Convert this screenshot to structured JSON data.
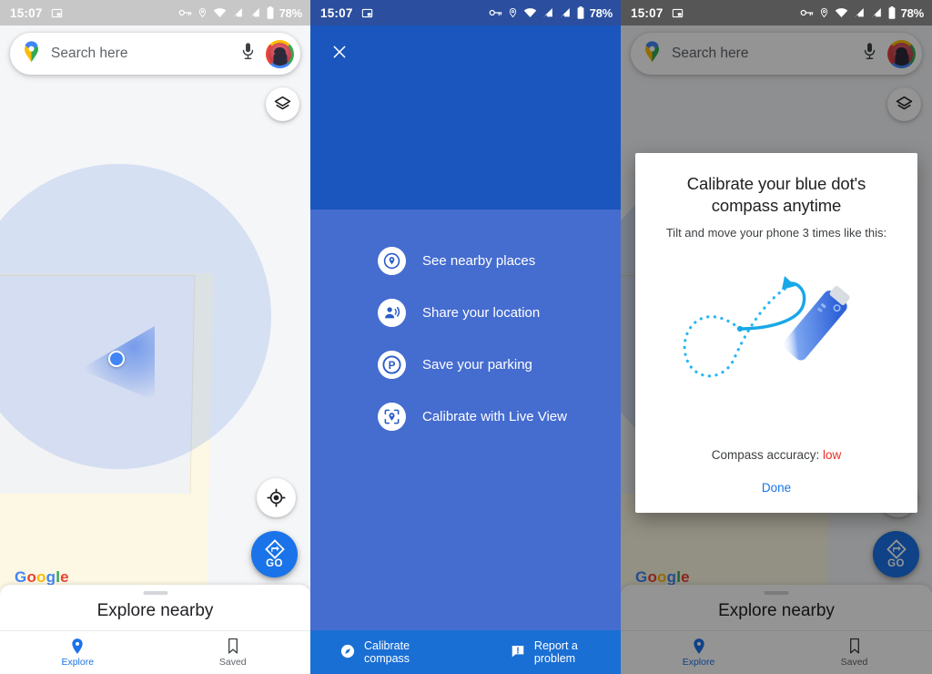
{
  "colors": {
    "accent_blue": "#1a73e8",
    "menu_blue_top": "#1a56bd",
    "menu_blue_body": "#4068ce",
    "menu_bottom_bar": "#1a6fd4",
    "status_light": "#c7c7c7",
    "status_blue": "#2b4f9e",
    "status_dim": "#565656",
    "accuracy_red": "#ea2d26",
    "map_land": "#fdf8e4",
    "map_bg": "#f5f6f8"
  },
  "status_bar": {
    "time": "15:07",
    "pip_icon": "picture-in-picture-icon",
    "icons": [
      "vpn-key-icon",
      "location-pin-icon",
      "wifi-icon",
      "signal-off-icon",
      "signal-off-icon",
      "battery-icon"
    ],
    "battery_percent": "78%"
  },
  "panel1": {
    "search": {
      "placeholder": "Search here",
      "value": "",
      "pin_icon": "google-maps-pin-icon",
      "mic_icon": "microphone-icon",
      "avatar": "account-avatar"
    },
    "map": {
      "layers_button": "layers-icon",
      "locate_button": "my-location-icon",
      "go_button_label": "GO",
      "go_button_icon": "directions-icon",
      "watermark": {
        "g1": "G",
        "o1": "o",
        "o2": "o",
        "g2": "g",
        "l": "l",
        "e": "e"
      }
    },
    "sheet": {
      "title": "Explore nearby"
    },
    "bottom_nav": [
      {
        "label": "Explore",
        "icon": "place-pin-icon",
        "active": true
      },
      {
        "label": "Saved",
        "icon": "bookmark-icon",
        "active": false
      }
    ]
  },
  "panel2": {
    "close_button": "close-icon",
    "menu_items": [
      {
        "label": "See nearby places",
        "icon": "nearby-pin-icon"
      },
      {
        "label": "Share your location",
        "icon": "share-location-icon"
      },
      {
        "label": "Save your parking",
        "icon": "parking-p-icon"
      },
      {
        "label": "Calibrate with Live View",
        "icon": "live-view-pin-icon"
      }
    ],
    "bottom_bar": [
      {
        "label": "Calibrate compass",
        "icon": "compass-icon"
      },
      {
        "label": "Report a problem",
        "icon": "feedback-icon"
      }
    ]
  },
  "panel3": {
    "dialog": {
      "title": "Calibrate your blue dot's compass anytime",
      "subtitle": "Tilt and move your phone 3 times like this:",
      "illustration": "figure-eight-phone-motion-icon",
      "accuracy_label": "Compass accuracy:",
      "accuracy_value": "low",
      "done_label": "Done"
    }
  }
}
